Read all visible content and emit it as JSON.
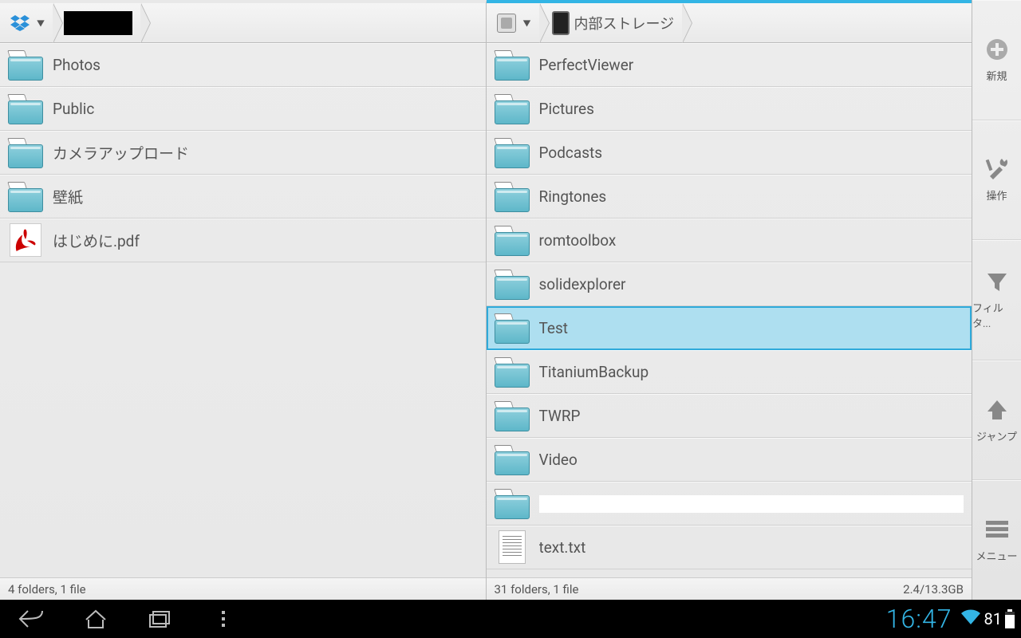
{
  "left_pane": {
    "crumb1_icon": "dropbox",
    "crumb2_label": "",
    "items": [
      {
        "type": "folder",
        "name": "Photos"
      },
      {
        "type": "folder",
        "name": "Public"
      },
      {
        "type": "folder",
        "name": "カメラアップロード"
      },
      {
        "type": "folder",
        "name": "壁紙"
      },
      {
        "type": "pdf",
        "name": "はじめに.pdf"
      }
    ],
    "status_left": "4 folders, 1 file",
    "status_right": ""
  },
  "right_pane": {
    "active": true,
    "crumb1_icon": "sdcard",
    "crumb2_icon": "device",
    "crumb2_label": "内部ストレージ",
    "items": [
      {
        "type": "folder",
        "name": "PerfectViewer"
      },
      {
        "type": "folder",
        "name": "Pictures"
      },
      {
        "type": "folder",
        "name": "Podcasts"
      },
      {
        "type": "folder",
        "name": "Ringtones"
      },
      {
        "type": "folder",
        "name": "romtoolbox"
      },
      {
        "type": "folder",
        "name": "solidexplorer"
      },
      {
        "type": "folder",
        "name": "Test",
        "selected": true
      },
      {
        "type": "folder",
        "name": "TitaniumBackup"
      },
      {
        "type": "folder",
        "name": "TWRP"
      },
      {
        "type": "folder",
        "name": "Video"
      },
      {
        "type": "folder",
        "name": "",
        "blank": true
      },
      {
        "type": "txt",
        "name": "text.txt"
      }
    ],
    "status_left": "31 folders, 1 file",
    "status_right": "2.4/13.3GB"
  },
  "sidebar": [
    {
      "icon": "plus",
      "label": "新規"
    },
    {
      "icon": "tools",
      "label": "操作"
    },
    {
      "icon": "filter",
      "label": "フィルタ..."
    },
    {
      "icon": "up",
      "label": "ジャンプ"
    },
    {
      "icon": "menu",
      "label": "メニュー"
    }
  ],
  "navbar": {
    "time": "16:47",
    "battery": "81"
  }
}
